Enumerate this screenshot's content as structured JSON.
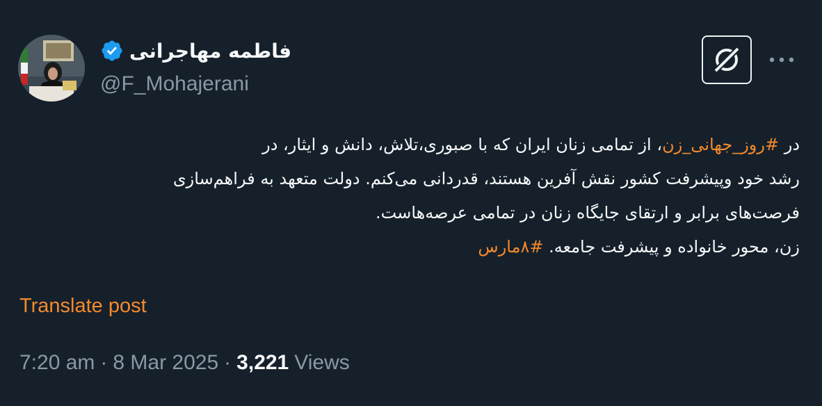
{
  "author": {
    "display_name": "فاطمه مهاجرانی",
    "handle": "@F_Mohajerani",
    "avatar_icon": "profile-photo",
    "verified_color": "#1d9bf0"
  },
  "actions": {
    "grok_icon": "grok-icon",
    "more_icon": "more-horizontal-icon"
  },
  "tweet": {
    "line1_prefix": "در ",
    "line1_hashtag": "#روز_جهانی_زن",
    "line1_suffix": "، از تمامی زنان ایران که با صبوری،تلاش، دانش و ایثار،  در",
    "line2": "رشد خود وپیشرفت کشور نقش آفرین هستند، قدردانی می‌کنم. دولت متعهد به فراهم‌سازی",
    "line3": "فرصت‌های برابر و ارتقای جایگاه زنان در تمامی عرصه‌هاست.",
    "line4_text": "زن، محور خانواده و پیشرفت جامعه. ",
    "line4_hashtag": "#۸مارس"
  },
  "translate_label": "Translate post",
  "meta": {
    "time": "7:20 am",
    "separator": "·",
    "date": "8 Mar 2025",
    "views_count": "3,221",
    "views_label": "Views"
  },
  "colors": {
    "background": "#15202b",
    "accent": "#f4892b",
    "secondary_text": "#8b98a5",
    "primary_text": "#f7f9f9"
  }
}
